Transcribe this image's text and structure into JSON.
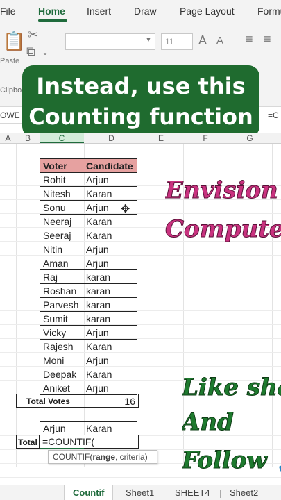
{
  "ribbon": {
    "tabs": [
      "File",
      "Home",
      "Insert",
      "Draw",
      "Page Layout",
      "Formu"
    ],
    "font_size": "11",
    "paste_label": "Paste",
    "clipboard_label": "Clipbo"
  },
  "formula_bar": {
    "name_box": "OWE",
    "formula_start": "=C"
  },
  "banner": {
    "line1": "Instead, use this",
    "line2": "Counting function"
  },
  "grid": {
    "columns": [
      "A",
      "B",
      "C",
      "D",
      "E",
      "F",
      "G"
    ],
    "selected_column": "C"
  },
  "table": {
    "headers": [
      "Voter",
      "Candidate"
    ],
    "rows": [
      [
        "Rohit",
        "Arjun"
      ],
      [
        "Nitesh",
        "Karan"
      ],
      [
        "Sonu",
        "Arjun"
      ],
      [
        "Neeraj",
        "Karan"
      ],
      [
        "Seeraj",
        "Karan"
      ],
      [
        "Nitin",
        "Arjun"
      ],
      [
        "Aman",
        "Arjun"
      ],
      [
        "Raj",
        "karan"
      ],
      [
        "Roshan",
        "karan"
      ],
      [
        "Parvesh",
        "karan"
      ],
      [
        "Sumit",
        "karan"
      ],
      [
        "Vicky",
        "Arjun"
      ],
      [
        "Rajesh",
        "Karan"
      ],
      [
        "Moni",
        "Arjun"
      ],
      [
        "Deepak",
        "Karan"
      ],
      [
        "Aniket",
        "Arjun"
      ]
    ],
    "total_votes_label": "Total Votes",
    "total_votes_value": "16"
  },
  "summary": {
    "candidates": [
      "Arjun",
      "Karan"
    ],
    "total_label": "Total",
    "formula": "=COUNTIF(",
    "tooltip_fn": "COUNTIF(",
    "tooltip_arg1": "range",
    "tooltip_rest": ", criteria)"
  },
  "overlays": {
    "brand_line1": "Envision",
    "brand_line2": "Computer s",
    "cta_line1": "Like shar",
    "cta_line2": "And",
    "cta_line3": "Follow 🙏"
  },
  "sheets": {
    "tabs": [
      "Countif",
      "Sheet1",
      "SHEET4",
      "Sheet2"
    ],
    "active": "Countif"
  },
  "colors": {
    "accent_green": "#1f6b3c",
    "banner_green": "#1f6b2f",
    "header_fill": "#e6a1a0",
    "brand_pink": "#c9327f"
  }
}
